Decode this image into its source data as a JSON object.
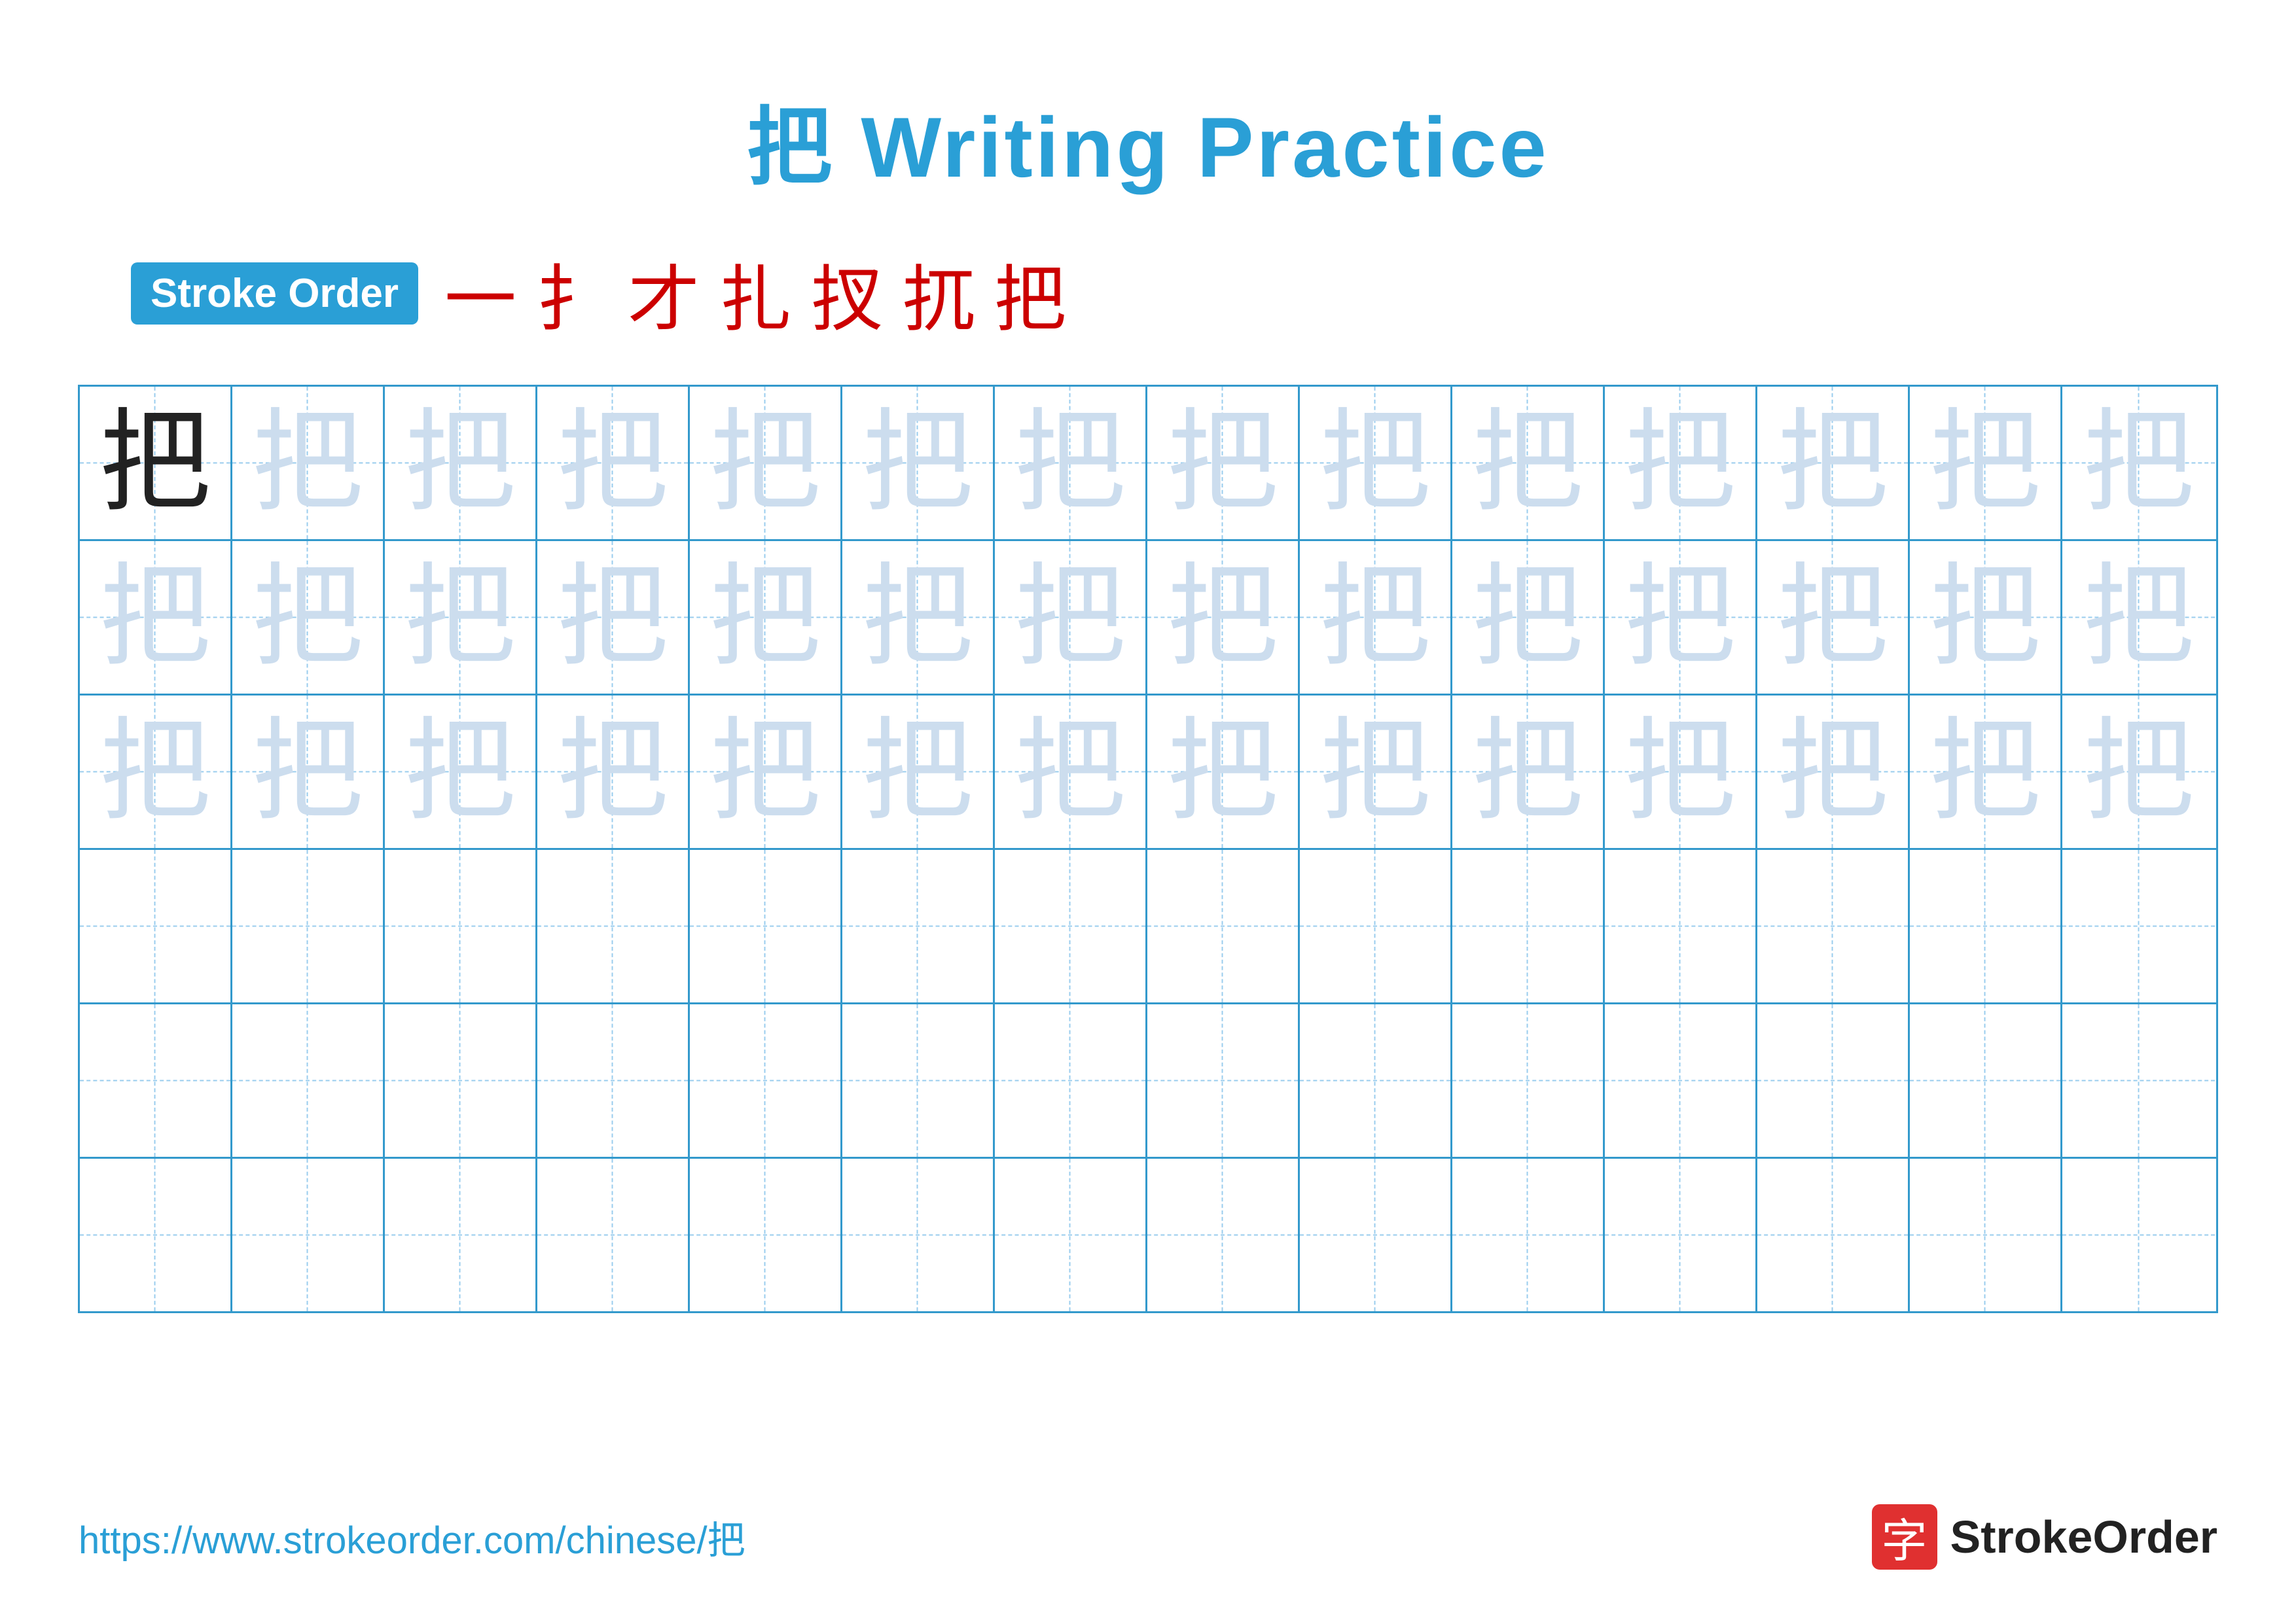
{
  "title": {
    "character": "把",
    "rest": " Writing Practice"
  },
  "stroke_order": {
    "badge_label": "Stroke Order",
    "strokes": [
      "一",
      "扌",
      "才",
      "扎",
      "扠",
      "扤",
      "把"
    ]
  },
  "grid": {
    "rows": 6,
    "cols": 14,
    "character": "把",
    "row_types": [
      "dark_then_light",
      "all_light",
      "all_light",
      "empty",
      "empty",
      "empty"
    ]
  },
  "footer": {
    "url": "https://www.strokeorder.com/chinese/把",
    "logo_char": "字",
    "logo_name": "StrokeOrder"
  }
}
